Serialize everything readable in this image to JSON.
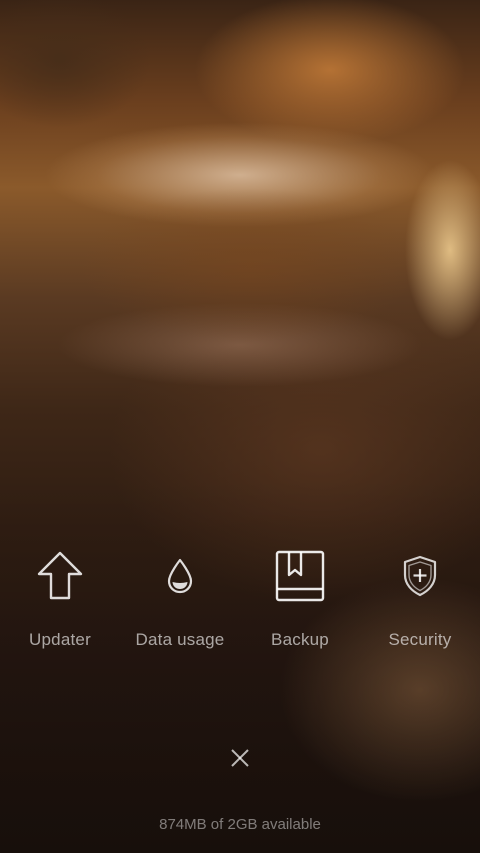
{
  "shortcuts": [
    {
      "label": "Updater",
      "icon": "arrow-up-icon"
    },
    {
      "label": "Data usage",
      "icon": "drop-icon"
    },
    {
      "label": "Backup",
      "icon": "book-bookmark-icon"
    },
    {
      "label": "Security",
      "icon": "shield-plus-icon"
    }
  ],
  "close": {
    "icon": "close-icon"
  },
  "storage": {
    "text": "874MB of 2GB available"
  },
  "colors": {
    "icon_primary": "#ffffff",
    "label_text": "#c9c3bf",
    "storage_text": "#a59c96"
  }
}
